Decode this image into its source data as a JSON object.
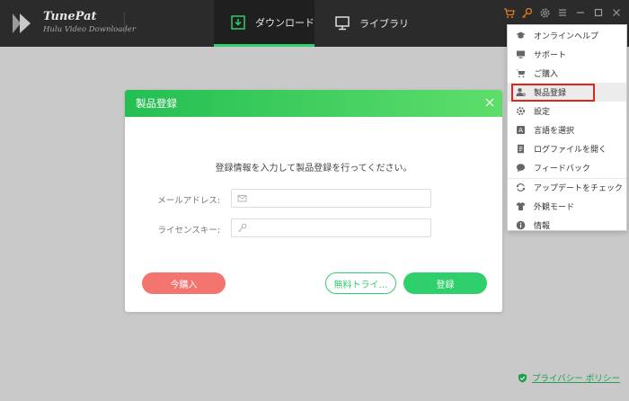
{
  "brand": {
    "name": "TunePat",
    "subtitle": "Hulu Video Downloader"
  },
  "nav": {
    "download_label": "ダウンロード",
    "library_label": "ライブラリ"
  },
  "modal": {
    "title": "製品登録",
    "instruction": "登録情報を入力して製品登録を行ってください。",
    "email_label": "メールアドレス:",
    "license_label": "ライセンスキー:",
    "email_value": "",
    "license_value": "",
    "buy_label": "今購入",
    "trial_label": "無料トライ…",
    "register_label": "登録"
  },
  "menu": {
    "items": [
      {
        "label": "オンラインヘルプ",
        "icon": "graduation-cap-icon"
      },
      {
        "label": "サポート",
        "icon": "monitor-icon"
      },
      {
        "label": "ご購入",
        "icon": "cart-icon"
      },
      {
        "label": "製品登録",
        "icon": "user-key-icon"
      },
      {
        "label": "設定",
        "icon": "gear-icon"
      },
      {
        "label": "言語を選択",
        "icon": "language-icon"
      },
      {
        "label": "ログファイルを開く",
        "icon": "log-file-icon"
      },
      {
        "label": "フィードバック",
        "icon": "chat-icon"
      },
      {
        "label": "アップデートをチェック",
        "icon": "refresh-icon"
      },
      {
        "label": "外観モード",
        "icon": "shirt-icon"
      },
      {
        "label": "情報",
        "icon": "info-icon"
      }
    ]
  },
  "privacy": {
    "label": "プライバシー ポリシー"
  },
  "colors": {
    "accent": "#2fcf6b",
    "buy": "#f47470",
    "highlight_border": "#e0251b",
    "titlebar": "#2b2b2b",
    "cart_icon": "#e07b1a"
  }
}
